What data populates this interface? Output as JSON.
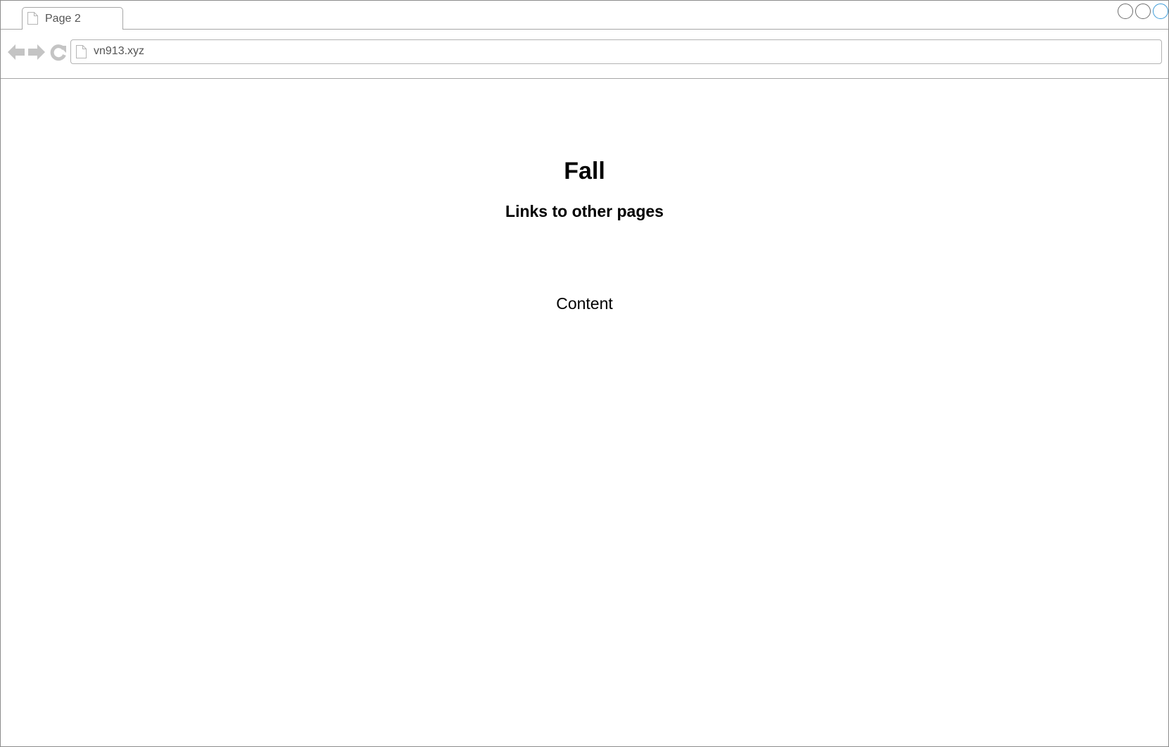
{
  "browser": {
    "tab": {
      "title": "Page 2",
      "icon": "page-icon"
    },
    "window_controls": [
      "minimize",
      "maximize",
      "close"
    ],
    "toolbar": {
      "back_icon": "back-arrow-icon",
      "forward_icon": "forward-arrow-icon",
      "reload_icon": "reload-icon",
      "address": "vn913.xyz"
    }
  },
  "page": {
    "title": "Fall",
    "links_heading": "Links to other pages",
    "content": "Content"
  },
  "colors": {
    "chrome_border": "#a6a6a6",
    "icon_gray": "#c4c4c4",
    "close_button": "#3c9bd8",
    "text": "#000000"
  }
}
